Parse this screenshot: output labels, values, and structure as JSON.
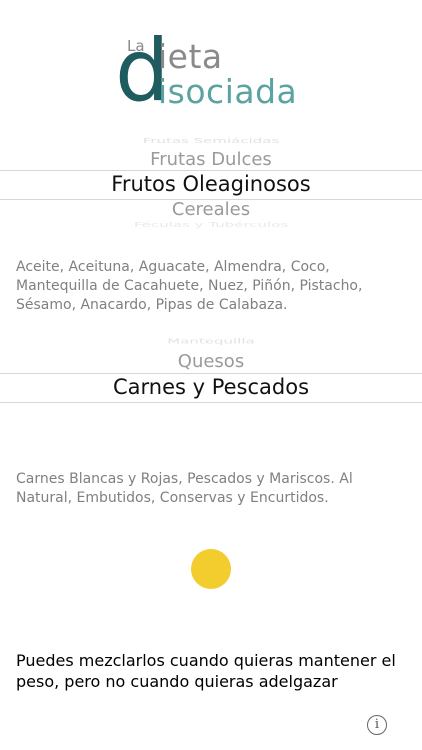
{
  "logo": {
    "la": "La",
    "d": "d",
    "ieta": "ieta",
    "isociada": "isociada"
  },
  "picker1": {
    "faded_top": "Frutas Semiácidas",
    "prev": "Frutas Dulces",
    "selected": "Frutos Oleaginosos",
    "next": "Cereales",
    "faded_bottom": "Féculas y Tubérculos"
  },
  "description1": "Aceite, Aceituna, Aguacate, Almendra, Coco, Mantequilla de Cacahuete, Nuez, Piñón, Pistacho, Sésamo, Anacardo, Pipas de Calabaza.",
  "picker2": {
    "faded_top": "Mantequilla",
    "prev": "Quesos",
    "selected": "Carnes y Pescados"
  },
  "description2": "Carnes Blancas y Rojas, Pescados y Mariscos. Al Natural, Embutidos, Conservas y Encurtidos.",
  "status_color": "#f2cd2d",
  "advice": "Puedes mezclarlos cuando quieras mantener el peso, pero no cuando quieras adelgazar",
  "info_icon": "i"
}
